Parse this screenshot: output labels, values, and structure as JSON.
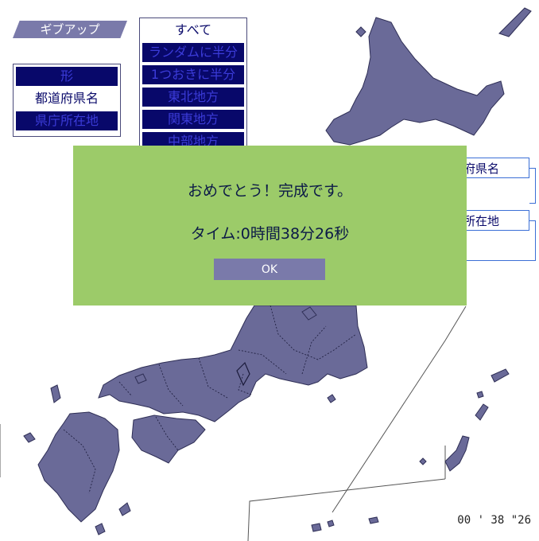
{
  "toolbar": {
    "giveup_label": "ギブアップ"
  },
  "mode_panel": {
    "items": [
      {
        "label": "形",
        "selected": false
      },
      {
        "label": "都道府県名",
        "selected": true
      },
      {
        "label": "県庁所在地",
        "selected": false
      }
    ]
  },
  "filter_panel": {
    "items": [
      {
        "label": "すべて",
        "selected": true
      },
      {
        "label": "ランダムに半分",
        "selected": false
      },
      {
        "label": "1つおきに半分",
        "selected": false
      },
      {
        "label": "東北地方",
        "selected": false
      },
      {
        "label": "関東地方",
        "selected": false
      },
      {
        "label": "中部地方",
        "selected": false
      }
    ]
  },
  "right_labels": {
    "prefecture": "府県名",
    "capital": "所在地"
  },
  "dialog": {
    "message": "おめでとう！完成です。",
    "time": "タイム:0時間38分26秒",
    "ok_label": "OK"
  },
  "timer": {
    "display": "00 ' 38 \"26"
  },
  "colors": {
    "map_fill": "#6a6a98",
    "dialog_bg": "#9ccb69",
    "panel_selected_bg": "#08086a",
    "accent": "#3b6fd6"
  }
}
